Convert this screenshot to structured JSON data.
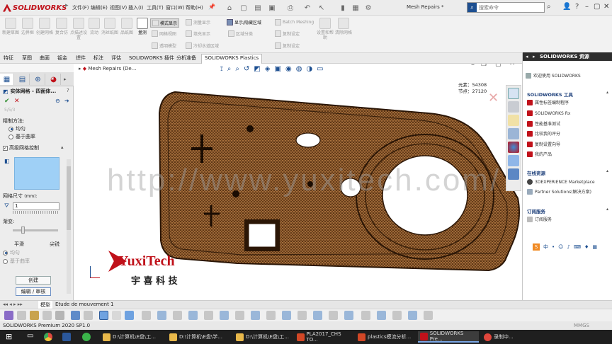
{
  "app": {
    "brand": "SOLIDWORKS",
    "doc_title": "Mesh Repairs *",
    "brand_color": "#c0111a",
    "accent": "#1d4f91"
  },
  "menu": [
    "文件(F)",
    "编辑(E)",
    "视图(V)",
    "插入(I)",
    "工具(T)",
    "窗口(W)",
    "帮助(H)"
  ],
  "search": {
    "placeholder": "搜索命令"
  },
  "ribbon": {
    "buttons": [
      "新建草图",
      "边界框",
      "创建网格",
      "复合仿",
      "点描述设置",
      "流动",
      "消丝纸图",
      "品纸图",
      "量测"
    ],
    "mid": [
      "模式显示",
      "网格视图",
      "透明模型",
      "测量显示",
      "填充显示"
    ],
    "group2": [
      "显示/隐藏区域",
      "区域分类",
      "Batch Meshing",
      "复制设定",
      "冷却水道区域"
    ],
    "right": [
      "设置和帮助",
      "清除网格"
    ],
    "small_right": [
      "复制设定"
    ]
  },
  "tabs": [
    "特征",
    "草图",
    "曲面",
    "钣金",
    "焊件",
    "标注",
    "评估",
    "SOLIDWORKS 插件",
    "分析准备",
    "SOLIDWORKS Plastics"
  ],
  "active_tab": "SOLIDWORKS Plastics",
  "left_panel": {
    "title": "实体网格 - 四面体...",
    "method_label": "精制方法:",
    "options": [
      "均匀",
      "基于曲率"
    ],
    "selected_option": "均匀",
    "advanced_label": "高级网格控制",
    "size_label": "网格尺寸",
    "size_unit": "(mm):",
    "size_value": "1",
    "gradient_label": "渐变:",
    "smooth_label": "平滑",
    "sharp_label": "尖锐",
    "options2": [
      "均匀",
      "基于曲率"
    ],
    "create_button": "创建",
    "edit_button": "编辑 / 审核",
    "gray_text": "5/5/3"
  },
  "viewport": {
    "tree_label": "Mesh Repairs (De...",
    "elements_label": "元素：54308",
    "nodes_label": "节点：27120",
    "watermark": "http://www.yuxitech.com/",
    "logo_en": "YuxiTech",
    "logo_cn": "宇 喜 科 技"
  },
  "bottom_tabs": [
    "模型",
    "Etude de mouvement 1"
  ],
  "statusbar": {
    "text": "SOLIDWORKS Premium 2020 SP1.0",
    "unit": "MMGS"
  },
  "right_pane": {
    "title": "SOLIDWORKS 资源",
    "welcome": "欢迎使用 SOLIDWORKS",
    "tools_title": "SOLIDWORKS 工具",
    "tools": [
      "属性标签编制程序",
      "SOLIDWORKS Rx",
      "性能基准测试",
      "比较我的评分",
      "复制设置向导",
      "我的产品"
    ],
    "online_title": "在线资源",
    "online": [
      "3DEXPERIENCE Marketplace",
      "Partner Solutions(解决方案)"
    ],
    "subscribe_title": "订阅服务",
    "subscribe": [
      "订阅服务"
    ]
  },
  "taskbar": {
    "apps": [
      "D:\\计算机\\E盘\\工...",
      "D:\\计算机\\E盘\\学...",
      "D:\\计算机\\E盘\\工...",
      "PLA2017_CHS TO...",
      "plastics模流分析...",
      "SOLIDWORKS Pre...",
      "录制中..."
    ],
    "active": "SOLIDWORKS Pre..."
  }
}
